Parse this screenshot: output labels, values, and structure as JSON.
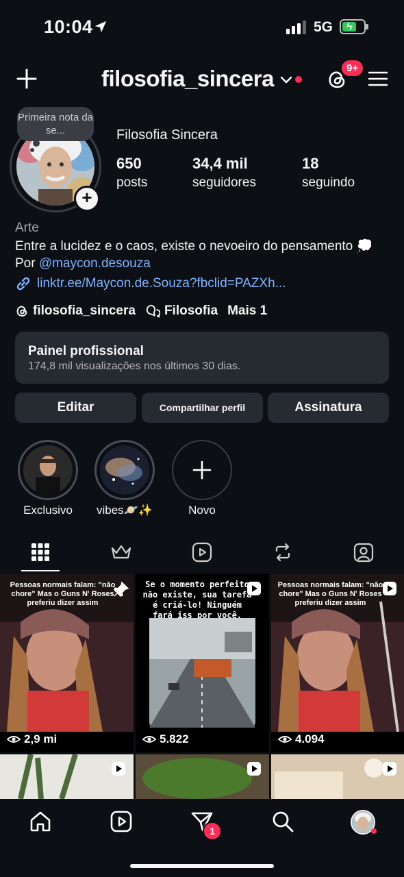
{
  "status": {
    "time": "10:04",
    "network": "5G"
  },
  "header": {
    "username": "filosofia_sincera",
    "threads_badge": "9+"
  },
  "note": {
    "text": "Primeira nota da se..."
  },
  "profile": {
    "full_name": "Filosofia Sincera",
    "stats": [
      {
        "value": "650",
        "label": "posts"
      },
      {
        "value": "34,4 mil",
        "label": "seguidores"
      },
      {
        "value": "18",
        "label": "seguindo"
      }
    ],
    "category": "Arte",
    "bio_line1": "Entre a lucidez e o caos, existe o nevoeiro do pensamento 💭",
    "bio_prefix": "Por ",
    "bio_mention": "@maycon.desouza",
    "link": "linktr.ee/Maycon.de.Souza?fbclid=PAZXh...",
    "chips": {
      "threads": "filosofia_sincera",
      "community": "Filosofia",
      "more": "Mais 1"
    }
  },
  "panel": {
    "title": "Painel profissional",
    "subtitle": "174,8 mil visualizações nos últimos 30 dias."
  },
  "buttons": {
    "edit": "Editar",
    "share": "Compartilhar perfil",
    "subscription": "Assinatura"
  },
  "highlights": [
    {
      "label": "Exclusivo"
    },
    {
      "label": "vibes🪐✨"
    },
    {
      "label": "Novo"
    }
  ],
  "grid": [
    {
      "caption": "Pessoas normais falam: \"não chore\" Mas o Guns N' Roses preferiu dizer assim",
      "views": "2,9 mi"
    },
    {
      "caption": "Se o momento perfeito não existe, sua tarefa é criá-lo! Ninguém fará iss por você.",
      "views": "5.822"
    },
    {
      "caption": "Pessoas normais falam: \"não chore\" Mas o Guns N' Roses preferiu dizer assim",
      "views": "4.094"
    }
  ],
  "nav": {
    "dm_badge": "1"
  },
  "colors": {
    "background": "#0c0f14",
    "card": "#262a31",
    "accent_link": "#7fb2ff",
    "badge": "#ff2d55"
  }
}
